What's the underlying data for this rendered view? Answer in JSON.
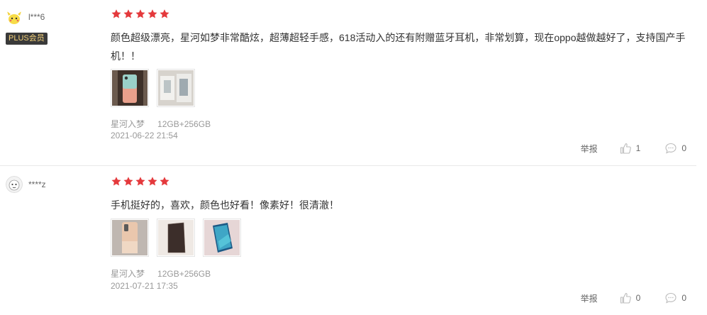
{
  "reviews": [
    {
      "username": "l***6",
      "badge": "PLUS会员",
      "rating": 5,
      "text": "颜色超级漂亮，星河如梦非常酷炫，超薄超轻手感，618活动入的还有附赠蓝牙耳机，非常划算，现在oppo越做越好了，支持国产手机！！",
      "color_variant": "星河入梦",
      "spec": "12GB+256GB",
      "date": "2021-06-22 21:54",
      "report_label": "举报",
      "likes": "1",
      "comments": "0",
      "photo_count": 2
    },
    {
      "username": "****z",
      "rating": 5,
      "text": "手机挺好的，喜欢，颜色也好看！像素好！很清澈！",
      "color_variant": "星河入梦",
      "spec": "12GB+256GB",
      "date": "2021-07-21 17:35",
      "report_label": "举报",
      "likes": "0",
      "comments": "0",
      "photo_count": 3
    }
  ],
  "colors": {
    "star": "#e4393c",
    "badge_bg": "#3a3a3a",
    "badge_text": "#f5d27a"
  }
}
